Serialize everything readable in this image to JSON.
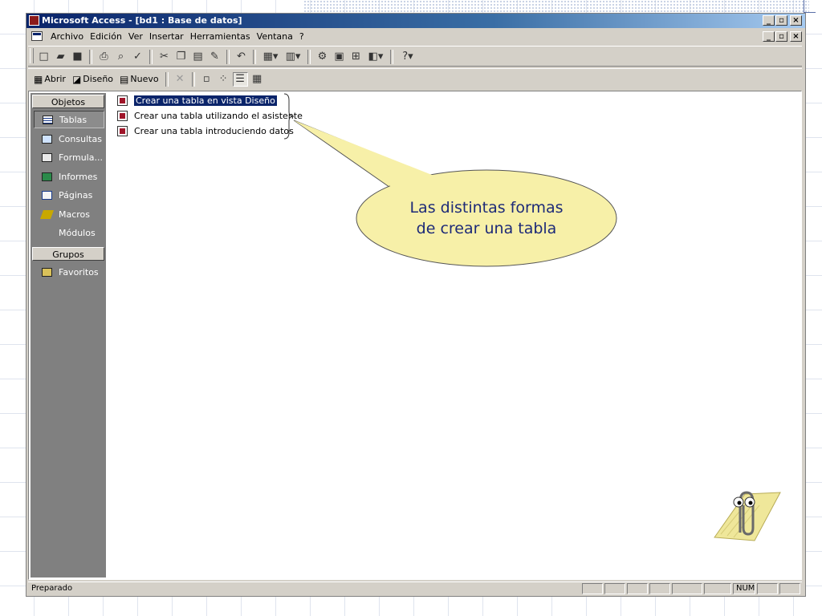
{
  "window": {
    "title": "Microsoft Access - [bd1 : Base de datos]",
    "min": "_",
    "max": "·",
    "close": "×"
  },
  "menu": {
    "items": [
      "Archivo",
      "Edición",
      "Ver",
      "Insertar",
      "Herramientas",
      "Ventana",
      "?"
    ]
  },
  "db_toolbar": {
    "open_label": "Abrir",
    "design_label": "Diseño",
    "new_label": "Nuevo"
  },
  "sidebar": {
    "objects_header": "Objetos",
    "groups_header": "Grupos",
    "items": [
      {
        "label": "Tablas",
        "icon": "table-icon"
      },
      {
        "label": "Consultas",
        "icon": "query-icon"
      },
      {
        "label": "Formula...",
        "icon": "form-icon"
      },
      {
        "label": "Informes",
        "icon": "report-icon"
      },
      {
        "label": "Páginas",
        "icon": "page-icon"
      },
      {
        "label": "Macros",
        "icon": "macro-icon"
      },
      {
        "label": "Módulos",
        "icon": "module-icon"
      }
    ],
    "group_items": [
      {
        "label": "Favoritos",
        "icon": "favorites-folder-icon"
      }
    ]
  },
  "objects": [
    {
      "label": "Crear una tabla en vista Diseño",
      "selected": true
    },
    {
      "label": "Crear una tabla utilizando el asistente",
      "selected": false
    },
    {
      "label": "Crear una tabla introduciendo datos",
      "selected": false
    }
  ],
  "callout": {
    "line1": "Las distintas formas",
    "line2": "de crear una tabla"
  },
  "status": {
    "text": "Preparado",
    "num": "NUM"
  },
  "colors": {
    "titlebar": "#0a246a",
    "selection": "#0a246a",
    "callout_fill": "#f7f0a8",
    "callout_text": "#1d2a78"
  }
}
